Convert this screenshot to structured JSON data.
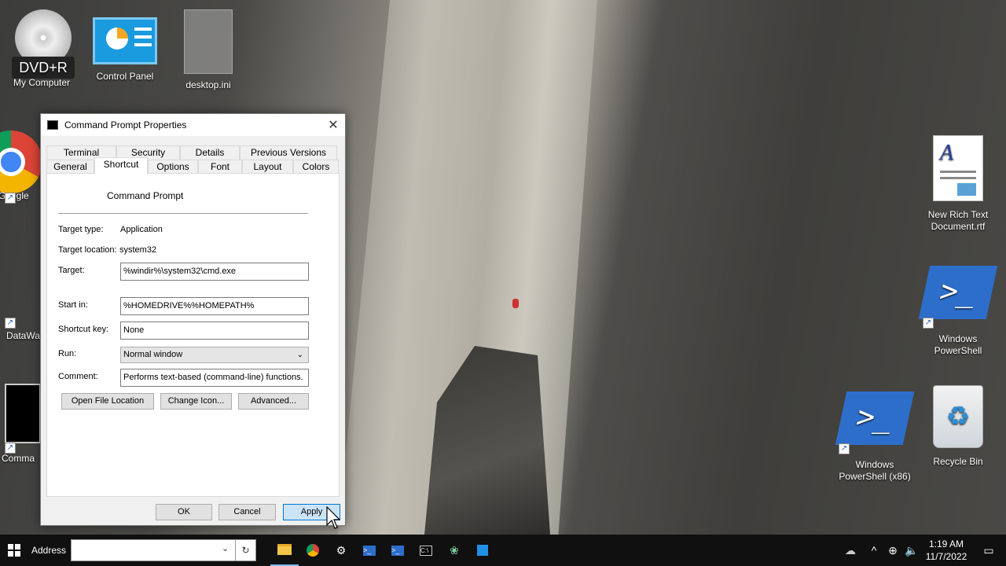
{
  "desktop": {
    "icons": {
      "my_computer": {
        "label": "My Computer",
        "badge": "DVD+R"
      },
      "control_panel": "Control Panel",
      "desktop_ini": "desktop.ini",
      "google": "Google",
      "datawg": "DataWa",
      "command": "Comma",
      "rich_text": "New Rich Text Document.rtf",
      "powershell": "Windows PowerShell",
      "powershell_x86": "Windows PowerShell (x86)",
      "recycle_bin": "Recycle Bin"
    }
  },
  "dialog": {
    "title": "Command Prompt Properties",
    "close": "✕",
    "tabs_back": [
      "Terminal",
      "Security",
      "Details",
      "Previous Versions"
    ],
    "tabs_front": [
      "General",
      "Shortcut",
      "Options",
      "Font",
      "Layout",
      "Colors"
    ],
    "active_tab": "Shortcut",
    "app_name": "Command Prompt",
    "target_type_label": "Target type:",
    "target_type_value": "Application",
    "target_location_label": "Target location:",
    "target_location_value": "system32",
    "target_label": "Target:",
    "target_value": "%windir%\\system32\\cmd.exe",
    "start_in_label": "Start in:",
    "start_in_value": "%HOMEDRIVE%%HOMEPATH%",
    "shortcut_key_label": "Shortcut key:",
    "shortcut_key_value": "None",
    "run_label": "Run:",
    "run_value": "Normal window",
    "comment_label": "Comment:",
    "comment_value": "Performs text-based (command-line) functions.",
    "open_file_location": "Open File Location",
    "change_icon": "Change Icon...",
    "advanced": "Advanced...",
    "ok": "OK",
    "cancel": "Cancel",
    "apply": "Apply"
  },
  "taskbar": {
    "address_label": "Address",
    "address_value": "",
    "time": "1:19 AM",
    "date": "11/7/2022"
  },
  "colors": {
    "accent": "#0078d7",
    "taskbar": "#101010"
  }
}
